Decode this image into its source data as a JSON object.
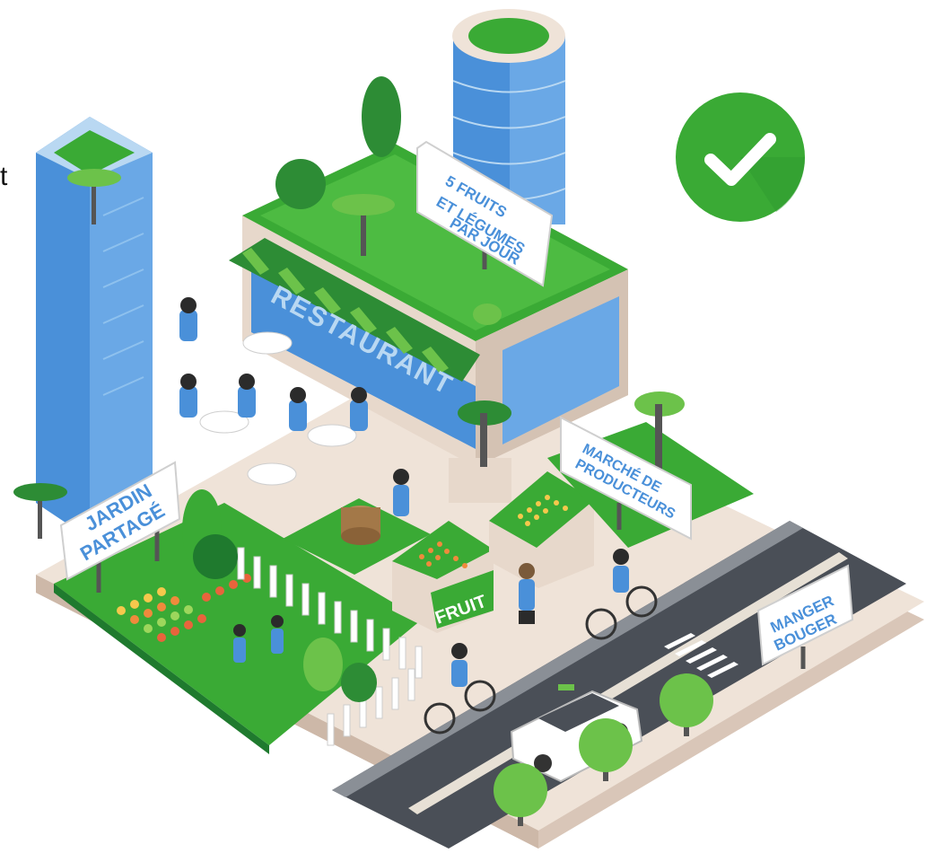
{
  "signs": {
    "fruits_line1": "5 FRUITS",
    "fruits_line2": "ET LÉGUMES",
    "fruits_line3": "PAR JOUR",
    "restaurant": "RESTAURANT",
    "jardin_line1": "JARDIN",
    "jardin_line2": "PARTAGÉ",
    "marche_line1": "MARCHÉ DE",
    "marche_line2": "PRODUCTEURS",
    "fruit": "FRUIT",
    "manger_line1": "MANGER",
    "manger_line2": "BOUGER"
  },
  "edge_text": "t",
  "colors": {
    "green": "#3aaa35",
    "dark_green": "#1f7a2e",
    "light_green": "#6cc24a",
    "blue": "#4a90d9",
    "sidewalk": "#eadcd0",
    "road": "#4a4f57",
    "check_bg": "#3aaa35"
  },
  "icons": {
    "badge": "checkmark-icon"
  }
}
